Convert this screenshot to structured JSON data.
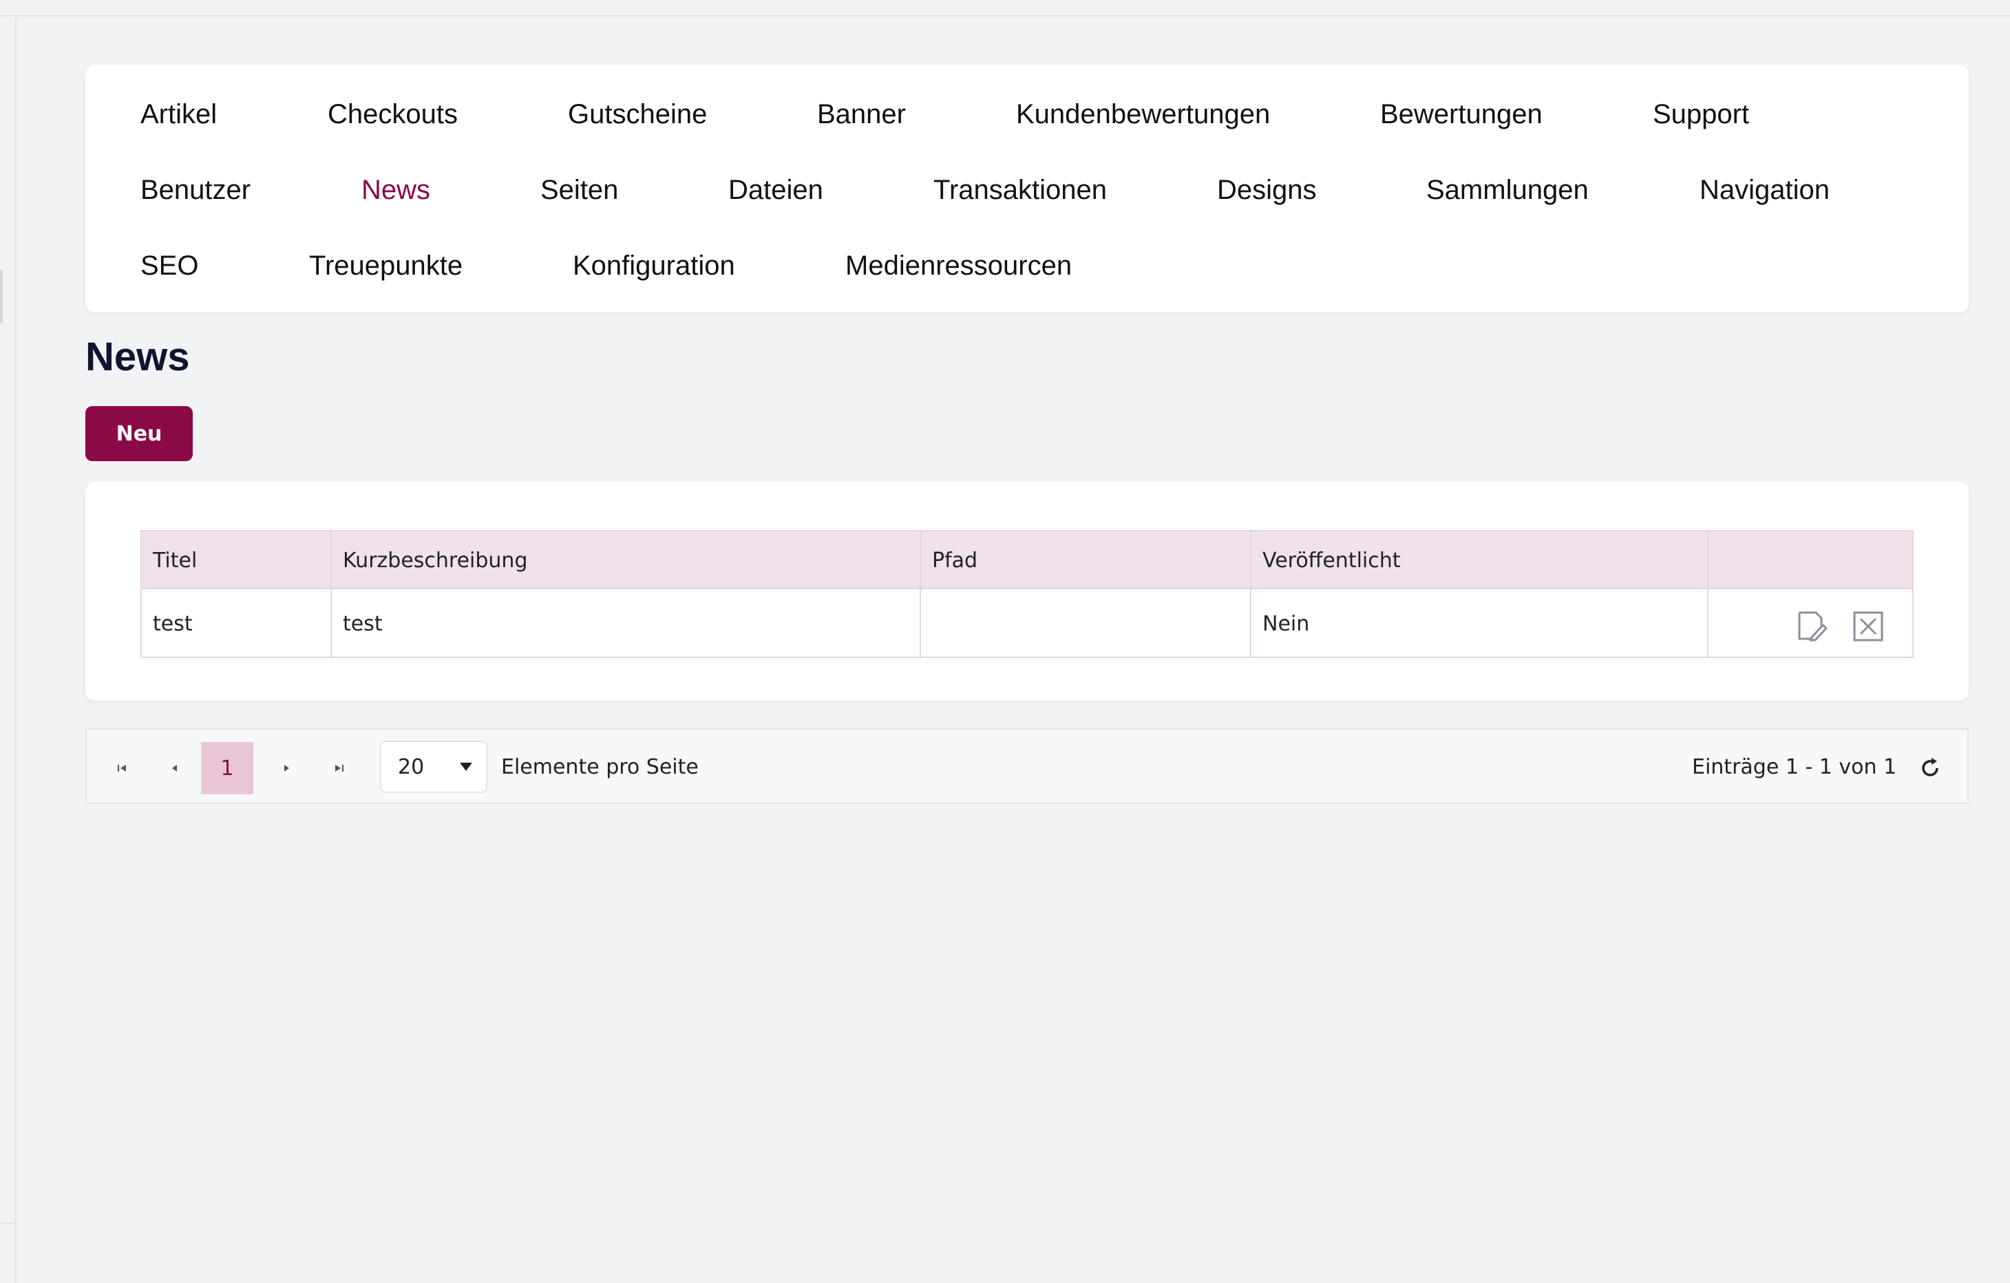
{
  "nav": {
    "items": [
      {
        "label": "Artikel",
        "active": false
      },
      {
        "label": "Checkouts",
        "active": false
      },
      {
        "label": "Gutscheine",
        "active": false
      },
      {
        "label": "Banner",
        "active": false
      },
      {
        "label": "Kundenbewertungen",
        "active": false
      },
      {
        "label": "Bewertungen",
        "active": false
      },
      {
        "label": "Support",
        "active": false
      },
      {
        "label": "Benutzer",
        "active": false
      },
      {
        "label": "News",
        "active": true
      },
      {
        "label": "Seiten",
        "active": false
      },
      {
        "label": "Dateien",
        "active": false
      },
      {
        "label": "Transaktionen",
        "active": false
      },
      {
        "label": "Designs",
        "active": false
      },
      {
        "label": "Sammlungen",
        "active": false
      },
      {
        "label": "Navigation",
        "active": false
      },
      {
        "label": "SEO",
        "active": false
      },
      {
        "label": "Treuepunkte",
        "active": false
      },
      {
        "label": "Konfiguration",
        "active": false
      },
      {
        "label": "Medienressourcen",
        "active": false
      }
    ]
  },
  "page": {
    "title": "News",
    "new_button_label": "Neu"
  },
  "table": {
    "columns": [
      "Titel",
      "Kurzbeschreibung",
      "Pfad",
      "Veröffentlicht",
      ""
    ],
    "rows": [
      {
        "titel": "test",
        "kurzbeschreibung": "test",
        "pfad": "",
        "veroeffentlicht": "Nein"
      }
    ],
    "row_actions": [
      "edit-icon",
      "delete-icon"
    ]
  },
  "pager": {
    "current_page": "1",
    "page_size": "20",
    "page_size_label": "Elemente pro Seite",
    "summary": "Einträge 1 - 1 von 1"
  },
  "colors": {
    "accent": "#8a0a45",
    "header_bg": "#f1e1ea",
    "current_page_bg": "#e9c6d6"
  }
}
